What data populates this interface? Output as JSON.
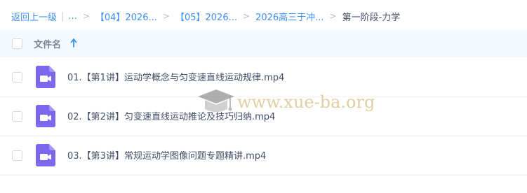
{
  "breadcrumb": {
    "back_label": "返回上一级",
    "ellipsis_label": "...",
    "crumbs": [
      "【04】2026...",
      "【05】2026...",
      "2026高三于冲..."
    ],
    "current": "第一阶段-力学"
  },
  "file_list": {
    "column_title": "文件名",
    "sort_icon": "arrow-up-icon",
    "files": [
      {
        "name": "01.【第1讲】运动学概念与匀变速直线运动规律.mp4",
        "icon": "video-file-icon"
      },
      {
        "name": "02.【第2讲】匀变速直线运动推论及技巧归纳.mp4",
        "icon": "video-file-icon"
      },
      {
        "name": "03.【第3讲】常规运动学图像问题专题精讲.mp4",
        "icon": "video-file-icon"
      }
    ]
  },
  "watermark": {
    "text": "www.xue-ba.org",
    "icon": "graduation-cap-icon"
  },
  "colors": {
    "link": "#3b8ff5",
    "text": "#424e67",
    "header_bg": "#f4f8ff",
    "video_icon": "#7b68ee",
    "watermark": "#d6be82"
  }
}
